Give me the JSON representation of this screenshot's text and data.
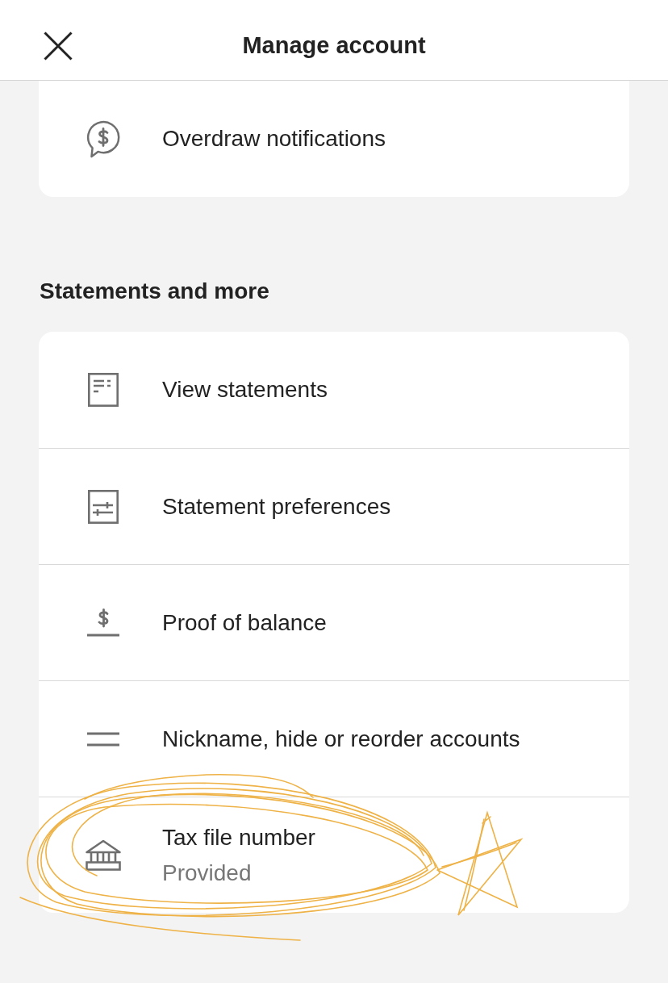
{
  "header": {
    "title": "Manage account"
  },
  "top_card": {
    "items": [
      {
        "label": "Overdraw notifications"
      }
    ]
  },
  "sections": [
    {
      "heading": "Statements and more",
      "items": [
        {
          "label": "View statements"
        },
        {
          "label": "Statement preferences"
        },
        {
          "label": "Proof of balance"
        },
        {
          "label": "Nickname, hide or reorder accounts"
        },
        {
          "label": "Tax file number",
          "status": "Provided"
        }
      ]
    }
  ]
}
